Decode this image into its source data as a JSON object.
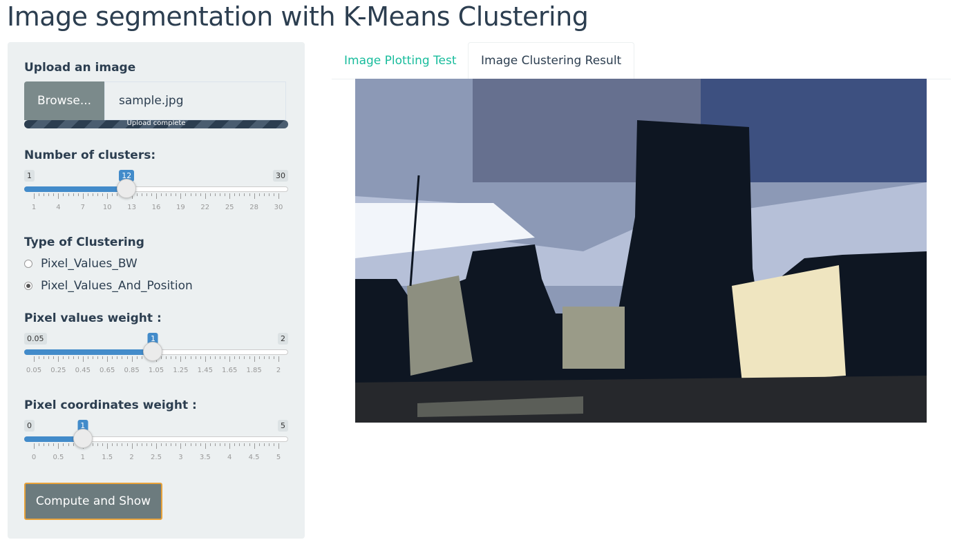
{
  "page_title": "Image segmentation with K-Means Clustering",
  "upload": {
    "label": "Upload an image",
    "browse_label": "Browse...",
    "filename": "sample.jpg",
    "progress_text": "Upload complete",
    "progress_fraction": 1.0
  },
  "clusters": {
    "label": "Number of clusters:",
    "min": "1",
    "max": "30",
    "value": "12",
    "value_fraction": 0.3793,
    "ticks": [
      "1",
      "4",
      "7",
      "10",
      "13",
      "16",
      "19",
      "22",
      "25",
      "28",
      "30"
    ]
  },
  "clustering_type": {
    "label": "Type of Clustering",
    "options": [
      "Pixel_Values_BW",
      "Pixel_Values_And_Position"
    ],
    "selected": "Pixel_Values_And_Position"
  },
  "pixel_values_weight": {
    "label": "Pixel values weight :",
    "min": "0.05",
    "max": "2",
    "value": "1",
    "value_fraction": 0.4872,
    "ticks": [
      "0.05",
      "0.25",
      "0.45",
      "0.65",
      "0.85",
      "1.05",
      "1.25",
      "1.45",
      "1.65",
      "1.85",
      "2"
    ]
  },
  "pixel_coordinates_weight": {
    "label": "Pixel coordinates weight :",
    "min": "0",
    "max": "5",
    "value": "1",
    "value_fraction": 0.2,
    "ticks": [
      "0",
      "0.5",
      "1",
      "1.5",
      "2",
      "2.5",
      "3",
      "3.5",
      "4",
      "4.5",
      "5"
    ]
  },
  "compute_button": "Compute and Show",
  "tabs": [
    {
      "label": "Image Plotting Test",
      "active": false
    },
    {
      "label": "Image Clustering Result",
      "active": true
    }
  ],
  "colors": {
    "accent": "#18bc9c",
    "slider": "#428bca",
    "panel": "#ecf0f1",
    "text": "#2c3e50"
  }
}
